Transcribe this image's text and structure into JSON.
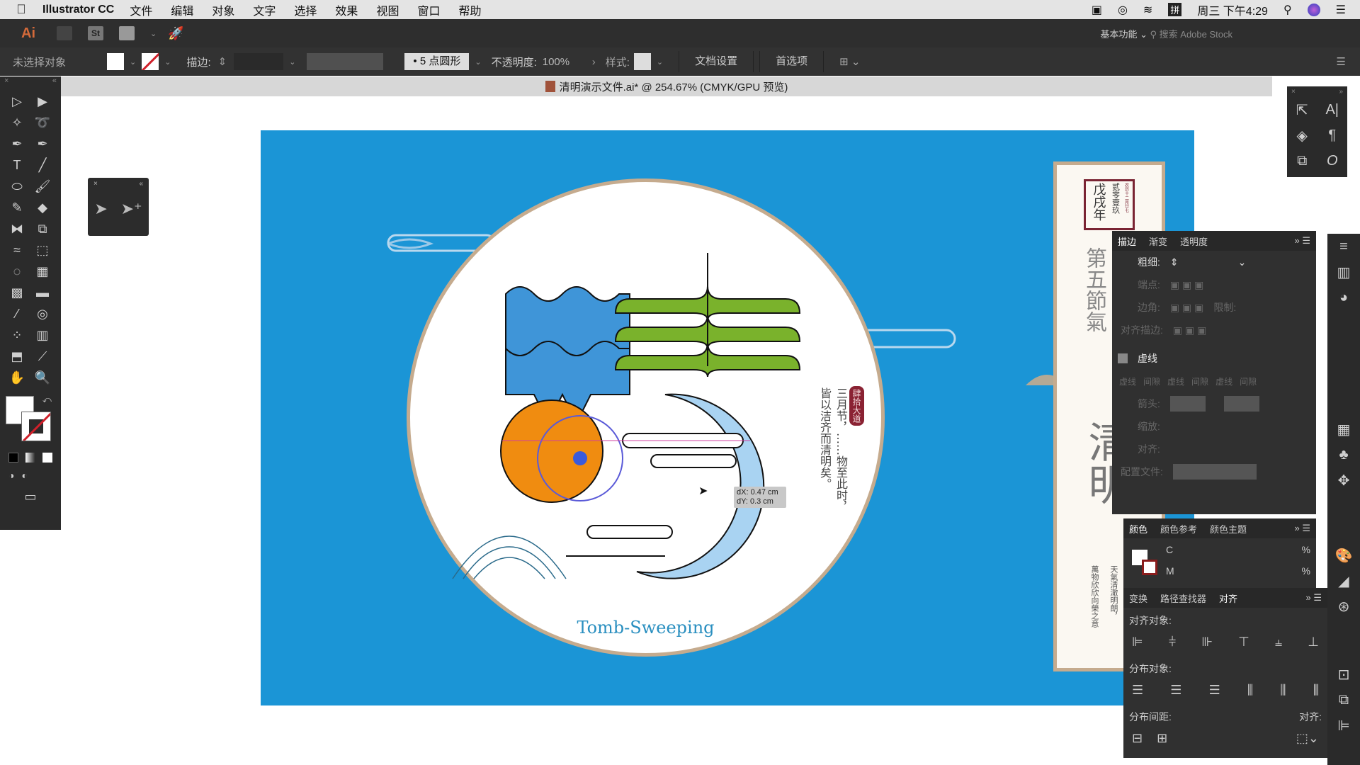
{
  "menubar": {
    "app_name": "Illustrator CC",
    "items": [
      "文件",
      "编辑",
      "对象",
      "文字",
      "选择",
      "效果",
      "视图",
      "窗口",
      "帮助"
    ],
    "clock": "周三 下午4:29"
  },
  "appbar": {
    "logo": "Ai",
    "stock_label": "St",
    "workspace": "基本功能",
    "search_placeholder": "搜索 Adobe Stock"
  },
  "control_bar": {
    "selection_status": "未选择对象",
    "stroke_label": "描边:",
    "brush": "5 点圆形",
    "opacity_label": "不透明度:",
    "opacity_value": "100%",
    "style_label": "样式:",
    "doc_setup": "文档设置",
    "preferences": "首选项"
  },
  "document": {
    "tab_title": "清明演示文件.ai* @ 254.67% (CMYK/GPU 预览)"
  },
  "tools": [
    {
      "icon": "selection-icon",
      "g": "▷"
    },
    {
      "icon": "direct-selection-icon",
      "g": "▶"
    },
    {
      "icon": "magic-wand-icon",
      "g": "✧"
    },
    {
      "icon": "lasso-icon",
      "g": "➰"
    },
    {
      "icon": "pen-icon",
      "g": "✒"
    },
    {
      "icon": "curvature-icon",
      "g": "✒"
    },
    {
      "icon": "type-icon",
      "g": "T"
    },
    {
      "icon": "line-icon",
      "g": "╱"
    },
    {
      "icon": "ellipse-icon",
      "g": "⬭"
    },
    {
      "icon": "paintbrush-icon",
      "g": "🖌"
    },
    {
      "icon": "shaper-icon",
      "g": "✎"
    },
    {
      "icon": "eraser-icon",
      "g": "◆"
    },
    {
      "icon": "reflect-icon",
      "g": "⧓"
    },
    {
      "icon": "scale-icon",
      "g": "⧉"
    },
    {
      "icon": "warp-icon",
      "g": "≈"
    },
    {
      "icon": "free-transform-icon",
      "g": "⬚"
    },
    {
      "icon": "shape-builder-icon",
      "g": "◌"
    },
    {
      "icon": "perspective-icon",
      "g": "▦"
    },
    {
      "icon": "mesh-icon",
      "g": "▩"
    },
    {
      "icon": "gradient-icon",
      "g": "▬"
    },
    {
      "icon": "eyedropper-icon",
      "g": "⁄"
    },
    {
      "icon": "blend-icon",
      "g": "◎"
    },
    {
      "icon": "symbol-sprayer-icon",
      "g": "⁘"
    },
    {
      "icon": "column-graph-icon",
      "g": "▥"
    },
    {
      "icon": "artboard-icon",
      "g": "⬒"
    },
    {
      "icon": "slice-icon",
      "g": "⟋"
    },
    {
      "icon": "hand-icon",
      "g": "✋"
    },
    {
      "icon": "zoom-icon",
      "g": "🔍"
    }
  ],
  "mini_panel": {
    "tools": [
      "anchor-select-icon",
      "add-anchor-icon"
    ]
  },
  "artwork": {
    "title": "Tomb-Sweeping",
    "poem_line1": "三月节，……物至此时，",
    "poem_line2": "皆以洁齐而清明矣。",
    "seal": "肆拾大道",
    "card_year": "戊戌年",
    "card_date": "贰零壹玖",
    "card_lunar": "农历十二月廿七",
    "card_heading": "第五節氣",
    "card_big": "清明",
    "card_sub1": "天氣清澈明朗，",
    "card_sub2": "萬物欣欣向榮之意",
    "colors": {
      "background": "#1b95d6",
      "orange": "#f08c10",
      "green": "#7ab22c",
      "blue": "#3f95d8",
      "light_blue": "#a9d3f2",
      "border": "#c5ab8e",
      "title": "#2a8fc0"
    }
  },
  "tooltip": {
    "dx": "dX: 0.47 cm",
    "dy": "dY: 0.3 cm"
  },
  "stroke_panel": {
    "tabs": [
      "描边",
      "渐变",
      "透明度"
    ],
    "weight_label": "粗细:",
    "cap_label": "端点:",
    "corner_label": "边角:",
    "limit_label": "限制:",
    "align_label": "对齐描边:",
    "dashed_label": "虚线",
    "dash_cols": [
      "虚线",
      "间隙",
      "虚线",
      "间隙",
      "虚线",
      "间隙"
    ],
    "arrow_label": "箭头:",
    "scale_label": "缩放:",
    "align2_label": "对齐:",
    "profile_label": "配置文件:"
  },
  "color_panel": {
    "tabs": [
      "颜色",
      "颜色参考",
      "颜色主题"
    ],
    "channels": [
      "C",
      "M"
    ],
    "unit": "%"
  },
  "align_panel": {
    "tabs": [
      "变换",
      "路径查找器",
      "对齐"
    ],
    "align_objects": "对齐对象:",
    "distribute_objects": "分布对象:",
    "distribute_spacing": "分布间距:",
    "align_to": "对齐:"
  }
}
